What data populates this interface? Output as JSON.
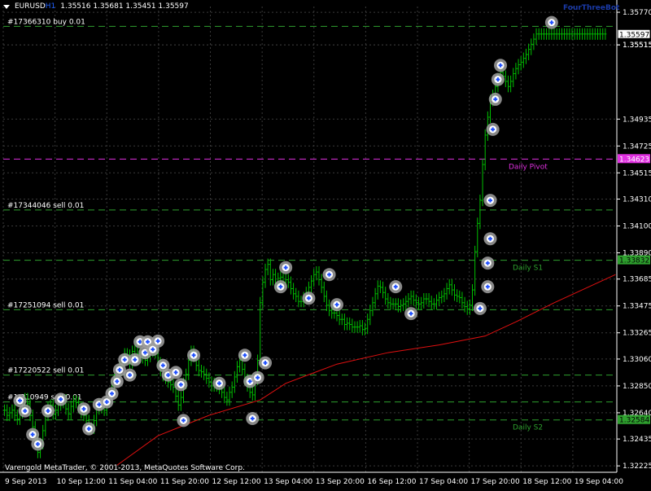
{
  "window": {
    "symbol": "EURUSD",
    "timeframe": "H1",
    "ohlc": "1.35516 1.35681 1.35451 1.35597",
    "ea_label": "FourThreeBot",
    "copyright": "Varengold MetaTrader, © 2001-2013, MetaQuotes Software Corp."
  },
  "colors": {
    "background": "#000000",
    "grid": "#3a3a3a",
    "bar": "#00c000",
    "moving_average": "#e01010",
    "order_line": "#2ea02e",
    "daily_pivot": "#e030e0",
    "price_marker": "#ffffff",
    "order_circle": "#a0a0a0",
    "order_arrow": "#2050ff"
  },
  "chart_data": {
    "type": "line",
    "title": "",
    "xlabel": "",
    "ylabel": "",
    "ylim": [
      1.32175,
      1.35815
    ],
    "x_ticks": [
      "9 Sep 2013",
      "10 Sep 12:00",
      "11 Sep 04:00",
      "11 Sep 20:00",
      "12 Sep 12:00",
      "13 Sep 04:00",
      "13 Sep 20:00",
      "16 Sep 12:00",
      "17 Sep 04:00",
      "17 Sep 20:00",
      "18 Sep 12:00",
      "19 Sep 04:00"
    ],
    "y_ticks": [
      "1.35770",
      "1.35515",
      "1.35515",
      "1.34935",
      "1.34725",
      "1.34515",
      "1.34310",
      "1.34100",
      "1.33890",
      "1.33685",
      "1.33475",
      "1.33265",
      "1.33060",
      "1.32850",
      "1.32640",
      "1.32435",
      "1.32225"
    ],
    "y_tick_values": [
      1.3577,
      1.35515,
      1.35515,
      1.34935,
      1.34725,
      1.34515,
      1.3431,
      1.341,
      1.3389,
      1.33685,
      1.33475,
      1.33265,
      1.3306,
      1.3285,
      1.3264,
      1.32435,
      1.32225
    ],
    "current_price": {
      "label": "1.35597",
      "value": 1.35597
    },
    "horizontal_levels": [
      {
        "label": "#17366310 buy 0.01",
        "value": 1.3566,
        "style": "order",
        "price_tag": ""
      },
      {
        "label": "#17344046 sell 0.01",
        "value": 1.34225,
        "style": "order",
        "price_tag": ""
      },
      {
        "label": "#17251094 sell 0.01",
        "value": 1.33445,
        "style": "order",
        "price_tag": ""
      },
      {
        "label": "#17220522 sell 0.01",
        "value": 1.32935,
        "style": "order",
        "price_tag": ""
      },
      {
        "label": "#1/210949 sell 0.01",
        "value": 1.32725,
        "style": "order",
        "price_tag": ""
      },
      {
        "label": "Daily Pivot",
        "value": 1.34623,
        "style": "pivot",
        "price_tag": "1.34623"
      },
      {
        "label": "Daily S1",
        "value": 1.33832,
        "style": "support",
        "price_tag": "1.33832"
      },
      {
        "label": "Daily S2",
        "value": 1.32584,
        "style": "support",
        "price_tag": "1.32584"
      }
    ],
    "series": [
      {
        "kind": "bars",
        "x": [
          0,
          1,
          2,
          3,
          4,
          5,
          6,
          7,
          8,
          9,
          10,
          11,
          12,
          13,
          14,
          15,
          16,
          17,
          18,
          19,
          20,
          21,
          22,
          23,
          24,
          25,
          26,
          27,
          28,
          29,
          30,
          31,
          32,
          33,
          34,
          35,
          36,
          37,
          38,
          39,
          40,
          41,
          42,
          43,
          44,
          45,
          46,
          47,
          48,
          49,
          50,
          51,
          52,
          53,
          54,
          55,
          56,
          57,
          58,
          59,
          60,
          61,
          62,
          63,
          64,
          65,
          66,
          67,
          68,
          69,
          70,
          71,
          72,
          73,
          74,
          75,
          76,
          77,
          78,
          79,
          80,
          81,
          82,
          83,
          84,
          85,
          86,
          87,
          88,
          89,
          90,
          91,
          92,
          93,
          94,
          95,
          96,
          97,
          98,
          99,
          100,
          101,
          102,
          103,
          104,
          105,
          106,
          107,
          108,
          109,
          110,
          111,
          112,
          113,
          114,
          115,
          116,
          117,
          118,
          119,
          120,
          121,
          122,
          123,
          124,
          125,
          126,
          127,
          128,
          129,
          130,
          131,
          132,
          133,
          134,
          135,
          136,
          137,
          138,
          139,
          140,
          141,
          142,
          143,
          144,
          145,
          146,
          147,
          148,
          149,
          150,
          151,
          152,
          153,
          154,
          155,
          156,
          157,
          158,
          159,
          160,
          161,
          162,
          163,
          164,
          165,
          166,
          167,
          168,
          169,
          170,
          171,
          172,
          173,
          174,
          175,
          176,
          177,
          178,
          179,
          180,
          181,
          182,
          183,
          184,
          185,
          186,
          187,
          188,
          189,
          190,
          191,
          192,
          193,
          194,
          195,
          196,
          197,
          198,
          199,
          200,
          201,
          202,
          203,
          204,
          205,
          206,
          207,
          208,
          209,
          210,
          211,
          212,
          213,
          214,
          215,
          216,
          217,
          218,
          219,
          220,
          221,
          222,
          223,
          224,
          225,
          226,
          227,
          228,
          229,
          230,
          231,
          232,
          233,
          234,
          235,
          236,
          237,
          238,
          239
        ],
        "close": [
          1.3266,
          1.3262,
          1.3264,
          1.3266,
          1.3262,
          1.3259,
          1.3264,
          1.327,
          1.3275,
          1.3271,
          1.3262,
          1.3253,
          1.3243,
          1.3233,
          1.324,
          1.325,
          1.3262,
          1.3268,
          1.327,
          1.3263,
          1.3266,
          1.327,
          1.3272,
          1.3274,
          1.3267,
          1.3263,
          1.3269,
          1.3273,
          1.3272,
          1.3268,
          1.3264,
          1.3262,
          1.3258,
          1.3252,
          1.3252,
          1.3258,
          1.3267,
          1.327,
          1.3268,
          1.3266,
          1.3273,
          1.3279,
          1.3285,
          1.329,
          1.3296,
          1.33,
          1.3305,
          1.331,
          1.3309,
          1.3303,
          1.3312,
          1.3317,
          1.331,
          1.3307,
          1.3308,
          1.3305,
          1.3308,
          1.3312,
          1.3313,
          1.3311,
          1.3303,
          1.3297,
          1.3293,
          1.3291,
          1.3288,
          1.3286,
          1.3284,
          1.3277,
          1.327,
          1.3276,
          1.3287,
          1.3294,
          1.3305,
          1.3312,
          1.3308,
          1.3301,
          1.3297,
          1.3296,
          1.3294,
          1.3291,
          1.3288,
          1.3285,
          1.3287,
          1.3285,
          1.3283,
          1.328,
          1.3276,
          1.3274,
          1.328,
          1.3284,
          1.3292,
          1.33,
          1.3305,
          1.3298,
          1.329,
          1.3285,
          1.328,
          1.3278,
          1.329,
          1.3305,
          1.335,
          1.3366,
          1.3376,
          1.338,
          1.3368,
          1.3372,
          1.3365,
          1.3369,
          1.337,
          1.3366,
          1.3368,
          1.3366,
          1.3361,
          1.3357,
          1.3355,
          1.3351,
          1.3351,
          1.3354,
          1.3358,
          1.3362,
          1.3367,
          1.3372,
          1.3374,
          1.3368,
          1.3362,
          1.3355,
          1.3348,
          1.3344,
          1.3342,
          1.3342,
          1.334,
          1.3337,
          1.3337,
          1.3333,
          1.3334,
          1.3333,
          1.3331,
          1.3331,
          1.3331,
          1.3332,
          1.3329,
          1.333,
          1.3337,
          1.3344,
          1.335,
          1.3357,
          1.3363,
          1.3362,
          1.3358,
          1.3353,
          1.335,
          1.3349,
          1.3349,
          1.3349,
          1.3347,
          1.3348,
          1.3349,
          1.3351,
          1.3353,
          1.3355,
          1.3352,
          1.335,
          1.3349,
          1.335,
          1.3353,
          1.3353,
          1.3351,
          1.3349,
          1.3349,
          1.3352,
          1.3354,
          1.3355,
          1.3357,
          1.3361,
          1.3364,
          1.336,
          1.3356,
          1.3355,
          1.3354,
          1.335,
          1.3347,
          1.3345,
          1.3348,
          1.336,
          1.339,
          1.3412,
          1.343,
          1.3458,
          1.3481,
          1.3495,
          1.3508,
          1.3512,
          1.3519,
          1.3525,
          1.353,
          1.3527,
          1.3523,
          1.3519,
          1.3523,
          1.3529,
          1.3533,
          1.3536,
          1.3538,
          1.3541,
          1.3544,
          1.3548,
          1.3552,
          1.3556,
          1.356,
          1.356,
          1.356,
          1.356,
          1.356,
          1.356,
          1.356,
          1.356,
          1.356,
          1.356,
          1.356,
          1.356,
          1.356,
          1.356,
          1.356,
          1.356,
          1.356,
          1.356,
          1.356,
          1.356,
          1.356,
          1.356,
          1.356,
          1.356,
          1.356,
          1.356,
          1.356,
          1.356
        ]
      },
      {
        "kind": "moving_average",
        "x": [
          44,
          60,
          80,
          100,
          110,
          130,
          150,
          170,
          188,
          200,
          215,
          240
        ],
        "y": [
          1.3223,
          1.3246,
          1.3262,
          1.3274,
          1.3287,
          1.3302,
          1.3311,
          1.3317,
          1.3324,
          1.3335,
          1.335,
          1.3372
        ]
      }
    ],
    "markers": [
      {
        "x": 6,
        "y": 1.32735
      },
      {
        "x": 8,
        "y": 1.32655
      },
      {
        "x": 11,
        "y": 1.3247
      },
      {
        "x": 13,
        "y": 1.32395
      },
      {
        "x": 17,
        "y": 1.32655
      },
      {
        "x": 22,
        "y": 1.32745
      },
      {
        "x": 31,
        "y": 1.3267
      },
      {
        "x": 33,
        "y": 1.32515
      },
      {
        "x": 37,
        "y": 1.32705
      },
      {
        "x": 40,
        "y": 1.32725
      },
      {
        "x": 42,
        "y": 1.3279
      },
      {
        "x": 44,
        "y": 1.32885
      },
      {
        "x": 45,
        "y": 1.32975
      },
      {
        "x": 47,
        "y": 1.33055
      },
      {
        "x": 49,
        "y": 1.32935
      },
      {
        "x": 51,
        "y": 1.33055
      },
      {
        "x": 53,
        "y": 1.33195
      },
      {
        "x": 55,
        "y": 1.3311
      },
      {
        "x": 56,
        "y": 1.33195
      },
      {
        "x": 58,
        "y": 1.33135
      },
      {
        "x": 60,
        "y": 1.332
      },
      {
        "x": 62,
        "y": 1.3301
      },
      {
        "x": 64,
        "y": 1.32935
      },
      {
        "x": 67,
        "y": 1.32955
      },
      {
        "x": 69,
        "y": 1.3286
      },
      {
        "x": 70,
        "y": 1.3258
      },
      {
        "x": 74,
        "y": 1.3309
      },
      {
        "x": 84,
        "y": 1.3287
      },
      {
        "x": 94,
        "y": 1.3309
      },
      {
        "x": 96,
        "y": 1.32885
      },
      {
        "x": 97,
        "y": 1.32595
      },
      {
        "x": 99,
        "y": 1.32915
      },
      {
        "x": 102,
        "y": 1.3303
      },
      {
        "x": 108,
        "y": 1.33625
      },
      {
        "x": 110,
        "y": 1.33775
      },
      {
        "x": 119,
        "y": 1.33535
      },
      {
        "x": 127,
        "y": 1.3372
      },
      {
        "x": 130,
        "y": 1.33485
      },
      {
        "x": 153,
        "y": 1.33625
      },
      {
        "x": 159,
        "y": 1.33415
      },
      {
        "x": 186,
        "y": 1.33455
      },
      {
        "x": 189,
        "y": 1.33625
      },
      {
        "x": 189,
        "y": 1.3381
      },
      {
        "x": 190,
        "y": 1.34
      },
      {
        "x": 190,
        "y": 1.343
      },
      {
        "x": 191,
        "y": 1.34855
      },
      {
        "x": 192,
        "y": 1.3509
      },
      {
        "x": 193,
        "y": 1.35245
      },
      {
        "x": 194,
        "y": 1.35355
      },
      {
        "x": 214,
        "y": 1.3569
      },
      {
        "x": 214,
        "y": 1.3593
      }
    ]
  }
}
